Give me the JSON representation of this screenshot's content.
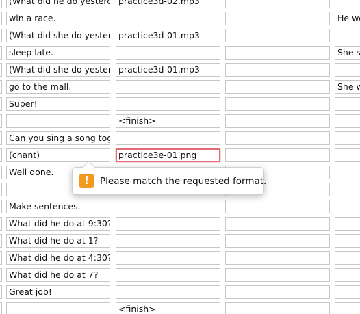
{
  "rows": [
    {
      "c1": "(What did he do yesterd",
      "c2": "practice3d-02.mp3",
      "c3": "",
      "c4": ""
    },
    {
      "c1": "win a race.",
      "c2": "",
      "c3": "",
      "c4": "He wo"
    },
    {
      "c1": "(What did she do yester",
      "c2": "practice3d-01.mp3",
      "c3": "",
      "c4": ""
    },
    {
      "c1": "sleep late.",
      "c2": "",
      "c3": "",
      "c4": "She s"
    },
    {
      "c1": "(What did she do yester",
      "c2": "practice3d-01.mp3",
      "c3": "",
      "c4": ""
    },
    {
      "c1": "go to the mall.",
      "c2": "",
      "c3": "",
      "c4": "She w"
    },
    {
      "c1": "Super!",
      "c2": "",
      "c3": "",
      "c4": ""
    },
    {
      "c1": "",
      "c2": "<finish>",
      "c3": "",
      "c4": ""
    },
    {
      "c1": "Can you sing a song tog",
      "c2": "",
      "c3": "",
      "c4": ""
    },
    {
      "c1": "(chant)",
      "c2": "practice3e-01.png",
      "c3": "",
      "c4": ""
    },
    {
      "c1": "Well done.",
      "c2": "",
      "c3": "",
      "c4": ""
    },
    {
      "c1": "",
      "c2": "",
      "c3": "",
      "c4": ""
    },
    {
      "c1": "Make sentences.",
      "c2": "",
      "c3": "",
      "c4": ""
    },
    {
      "c1": "What did he do at 9:30?",
      "c2": "",
      "c3": "",
      "c4": ""
    },
    {
      "c1": "What did he do at 1?",
      "c2": "",
      "c3": "",
      "c4": ""
    },
    {
      "c1": "What did he do at 4:30?",
      "c2": "",
      "c3": "",
      "c4": ""
    },
    {
      "c1": "What did he do at 7?",
      "c2": "",
      "c3": "",
      "c4": ""
    },
    {
      "c1": "Great job!",
      "c2": "",
      "c3": "",
      "c4": ""
    },
    {
      "c1": "",
      "c2": "<finish>",
      "c3": "",
      "c4": ""
    }
  ],
  "validation": {
    "row": 9,
    "column": "c2",
    "message": "Please match the requested format.",
    "icon": "warning-icon",
    "icon_glyph": "!",
    "icon_color": "#f29a1f",
    "border_color": "#e46a78"
  }
}
